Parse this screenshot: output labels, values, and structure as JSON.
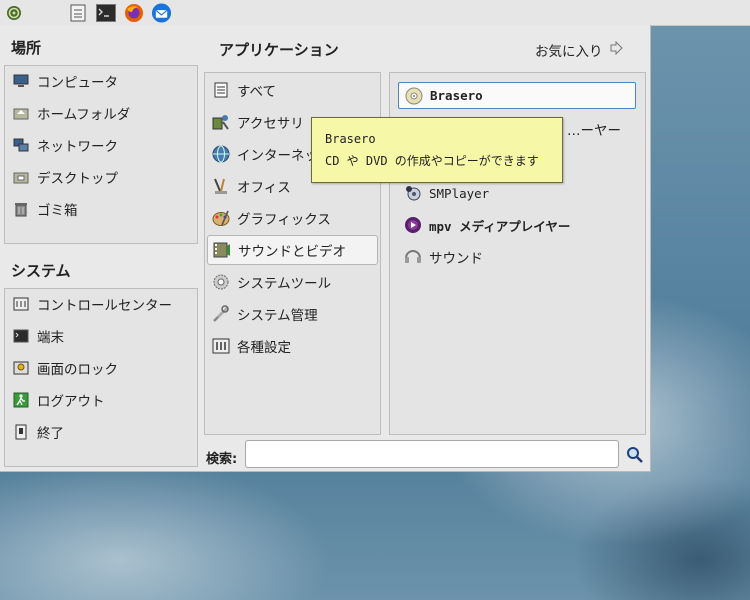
{
  "panel": {
    "icons": [
      "mint-menu-icon",
      "file-manager-icon",
      "terminal-icon",
      "firefox-icon",
      "thunderbird-icon"
    ]
  },
  "places": {
    "title": "場所",
    "items": [
      {
        "label": "コンピュータ",
        "icon": "computer-icon"
      },
      {
        "label": "ホームフォルダ",
        "icon": "home-folder-icon"
      },
      {
        "label": "ネットワーク",
        "icon": "network-icon"
      },
      {
        "label": "デスクトップ",
        "icon": "desktop-folder-icon"
      },
      {
        "label": "ゴミ箱",
        "icon": "trash-icon"
      }
    ]
  },
  "system": {
    "title": "システム",
    "items": [
      {
        "label": "コントロールセンター",
        "icon": "control-center-icon"
      },
      {
        "label": "端末",
        "icon": "terminal-icon"
      },
      {
        "label": "画面のロック",
        "icon": "lock-screen-icon"
      },
      {
        "label": "ログアウト",
        "icon": "logout-icon"
      },
      {
        "label": "終了",
        "icon": "shutdown-icon"
      }
    ]
  },
  "applications": {
    "title": "アプリケーション",
    "favorites_label": "お気に入り",
    "categories": [
      {
        "label": "すべて",
        "icon": "all-apps-icon"
      },
      {
        "label": "アクセサリ",
        "icon": "accessories-icon"
      },
      {
        "label": "インターネット",
        "icon": "internet-globe-icon"
      },
      {
        "label": "オフィス",
        "icon": "office-icon"
      },
      {
        "label": "グラフィックス",
        "icon": "graphics-icon"
      },
      {
        "label": "サウンドとビデオ",
        "icon": "sound-video-icon",
        "selected": true
      },
      {
        "label": "システムツール",
        "icon": "system-tools-icon"
      },
      {
        "label": "システム管理",
        "icon": "system-admin-icon"
      },
      {
        "label": "各種設定",
        "icon": "preferences-icon"
      }
    ],
    "apps": [
      {
        "label": "Brasero",
        "icon": "brasero-disc-icon",
        "selected": true
      },
      {
        "label": "…ーヤー",
        "icon": "media-player-icon"
      },
      {
        "label": "",
        "icon": ""
      },
      {
        "label": "SMPlayer",
        "icon": "smplayer-icon"
      },
      {
        "label": "mpv メディアプレイヤー",
        "icon": "mpv-icon"
      },
      {
        "label": "サウンド",
        "icon": "sound-icon"
      }
    ]
  },
  "tooltip": {
    "title": "Brasero",
    "description": "CD や DVD の作成やコピーができます"
  },
  "search": {
    "label": "検索:",
    "value": ""
  },
  "colors": {
    "selection_border": "#4a86c8",
    "tooltip_bg": "#f7f7a8",
    "menu_bg": "#e9e9e9"
  }
}
